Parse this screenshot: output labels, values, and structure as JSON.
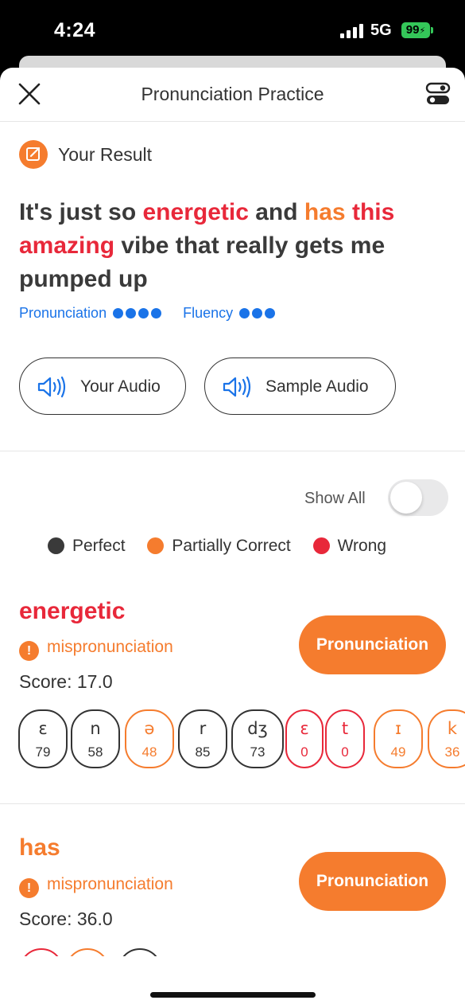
{
  "status": {
    "time": "4:24",
    "network": "5G",
    "battery": "99"
  },
  "nav": {
    "title": "Pronunciation Practice",
    "close_icon": "close-icon",
    "settings_icon": "toggles-icon"
  },
  "result": {
    "heading": "Your Result",
    "sentence_words": [
      {
        "text": "It's just so ",
        "status": "perfect"
      },
      {
        "text": "energetic",
        "status": "wrong"
      },
      {
        "text": " and ",
        "status": "perfect"
      },
      {
        "text": "has",
        "status": "partial"
      },
      {
        "text": " ",
        "status": "perfect"
      },
      {
        "text": "this",
        "status": "wrong"
      },
      {
        "text": " ",
        "status": "perfect"
      },
      {
        "text": "amazing",
        "status": "wrong"
      },
      {
        "text": " vibe that really gets me pumped up",
        "status": "perfect"
      }
    ],
    "pronunciation_label": "Pronunciation",
    "pronunciation_dots": 4,
    "fluency_label": "Fluency",
    "fluency_dots": 3
  },
  "audio": {
    "your_audio": "Your Audio",
    "sample_audio": "Sample Audio"
  },
  "show_all": {
    "label": "Show All",
    "enabled": false
  },
  "legend": [
    {
      "label": "Perfect",
      "color": "#3a3a3a"
    },
    {
      "label": "Partially Correct",
      "color": "#f57c2e"
    },
    {
      "label": "Wrong",
      "color": "#e8283a"
    }
  ],
  "words": [
    {
      "word": "energetic",
      "color": "#e8283a",
      "issue": "mispronunciation",
      "score": "Score: 17.0",
      "button": "Pronunciation",
      "phonemes": [
        {
          "sym": "ɛ",
          "val": "79",
          "status": "perfect"
        },
        {
          "sym": "n",
          "val": "58",
          "status": "perfect"
        },
        {
          "sym": "ə",
          "val": "48",
          "status": "partial"
        },
        {
          "sym": "r",
          "val": "85",
          "status": "perfect"
        },
        {
          "sym": "dʒ",
          "val": "73",
          "status": "perfect"
        },
        {
          "sym": "ɛ",
          "val": "0",
          "status": "wrong"
        },
        {
          "sym": "t",
          "val": "0",
          "status": "wrong"
        },
        {
          "sym": "ɪ",
          "val": "49",
          "status": "partial"
        },
        {
          "sym": "k",
          "val": "36",
          "status": "partial"
        }
      ]
    },
    {
      "word": "has",
      "color": "#f57c2e",
      "issue": "mispronunciation",
      "score": "Score: 36.0",
      "button": "Pronunciation",
      "phoneme_ring_statuses": [
        "wrong",
        "partial",
        "perfect"
      ]
    }
  ]
}
